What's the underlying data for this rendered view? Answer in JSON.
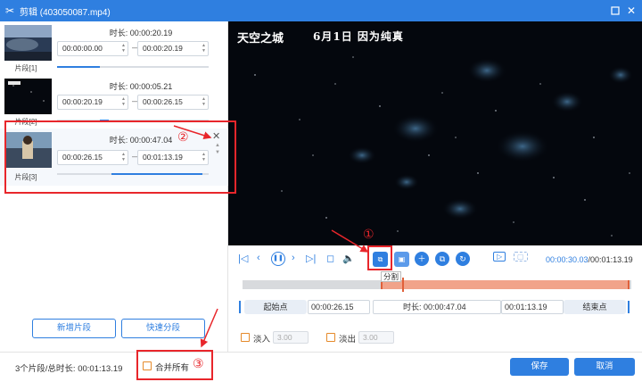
{
  "window": {
    "title": "剪辑 (403050087.mp4)",
    "icon": "scissors-icon"
  },
  "clips": [
    {
      "label": "片段[1]",
      "duration_label": "时长:",
      "duration": "00:00:20.19",
      "start": "00:00:00.00",
      "end": "00:00:20.19",
      "progress": 0.28
    },
    {
      "label": "片段[2]",
      "duration_label": "时长:",
      "duration": "00:00:05.21",
      "start": "00:00:20.19",
      "end": "00:00:26.15",
      "progress": 0.06
    },
    {
      "label": "片段[3]",
      "duration_label": "时长:",
      "duration": "00:00:47.04",
      "start": "00:00:26.15",
      "end": "00:01:13.19",
      "progress": 0.6
    }
  ],
  "left_buttons": {
    "add_segment": "新增片段",
    "quick_segment": "快速分段"
  },
  "footer": {
    "status": "3个片段/总时长: 00:01:13.19",
    "merge_all": "合并所有",
    "save": "保存",
    "cancel": "取消"
  },
  "video": {
    "title_logo": "天空之城",
    "caption": "6月1日  因为纯真"
  },
  "playback": {
    "current_time": "00:00:30.03",
    "total_time": "/00:01:13.19",
    "split_tooltip": "分割",
    "timeline_selection_start": 0.355,
    "timeline_selection_end": 1.0,
    "playhead": 0.41
  },
  "segment_editor": {
    "start_button": "起始点",
    "start_value": "00:00:26.15",
    "duration_label": "时长:",
    "duration_value": "00:00:47.04",
    "end_value": "00:01:13.19",
    "end_button": "结束点"
  },
  "fade": {
    "fade_in_label": "淡入",
    "fade_in_value": "3.00",
    "fade_out_label": "淡出",
    "fade_out_value": "3.00"
  },
  "annotations": {
    "n1": "①",
    "n2": "②",
    "n3": "③"
  },
  "colors": {
    "accent": "#2f7fe0",
    "annotation": "#e8262b",
    "selection": "#f1a38a",
    "checkbox": "#e58a2a"
  }
}
